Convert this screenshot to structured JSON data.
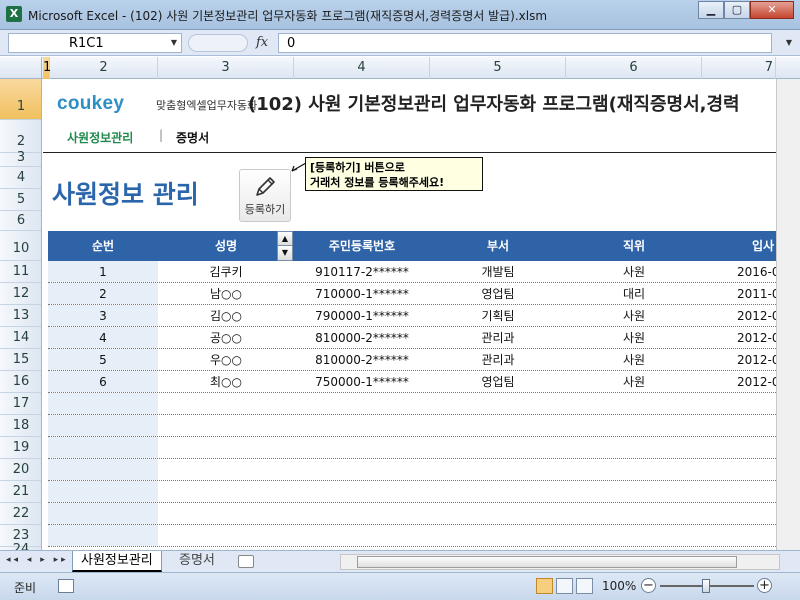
{
  "window": {
    "app_icon": "X",
    "title": "Microsoft Excel - (102) 사원 기본정보관리 업무자동화 프로그램(재직증명서,경력증명서 발급).xlsm",
    "minimize": "▁",
    "maximize": "▢",
    "close": "✕"
  },
  "formula_bar": {
    "name_box": "R1C1",
    "fx": "fx",
    "value": "0"
  },
  "columns": [
    "1",
    "2",
    "3",
    "4",
    "5",
    "6",
    "7"
  ],
  "rows": [
    "1",
    "2",
    "3",
    "4",
    "5",
    "6",
    "10",
    "11",
    "12",
    "13",
    "14",
    "15",
    "16",
    "17",
    "18",
    "19",
    "20",
    "21",
    "22",
    "23",
    "24"
  ],
  "sheet": {
    "brand_logo": "coukey",
    "brand_sub": "맞춤형엑셀업무자동화",
    "doc_title": "(102) 사원 기본정보관리 업무자동화 프로그램(재직증명서,경력",
    "nav_active": "사원정보관리",
    "nav_sep": "|",
    "nav_other": "증명서",
    "heading": "사원정보 관리",
    "register_button": "등록하기",
    "callout_line1": "[등록하기] 버튼으로",
    "callout_line2": "거래처 정보를 등록해주세요!"
  },
  "table": {
    "headers": [
      "순번",
      "성명",
      "주민등록번호",
      "부서",
      "직위",
      "입사"
    ],
    "spinner_up": "▲",
    "spinner_down": "▼",
    "rows": [
      [
        "1",
        "김쿠키",
        "910117-2******",
        "개발팀",
        "사원",
        "2016-0"
      ],
      [
        "2",
        "남○○",
        "710000-1******",
        "영업팀",
        "대리",
        "2011-0"
      ],
      [
        "3",
        "김○○",
        "790000-1******",
        "기획팀",
        "사원",
        "2012-0"
      ],
      [
        "4",
        "공○○",
        "810000-2******",
        "관리과",
        "사원",
        "2012-0"
      ],
      [
        "5",
        "우○○",
        "810000-2******",
        "관리과",
        "사원",
        "2012-0"
      ],
      [
        "6",
        "최○○",
        "750000-1******",
        "영업팀",
        "사원",
        "2012-0"
      ]
    ]
  },
  "sheet_tabs": {
    "nav": "◂◂ ◂ ▸ ▸▸",
    "tab1": "사원정보관리",
    "tab2": "증명서"
  },
  "status": {
    "ready": "준비",
    "zoom": "100%",
    "zoom_minus": "−",
    "zoom_plus": "+"
  },
  "colors": {
    "accent_blue": "#2f63a8",
    "heading_blue": "#2b66ac",
    "nav_green": "#1e8a4b",
    "selection": "#f1c15f"
  }
}
